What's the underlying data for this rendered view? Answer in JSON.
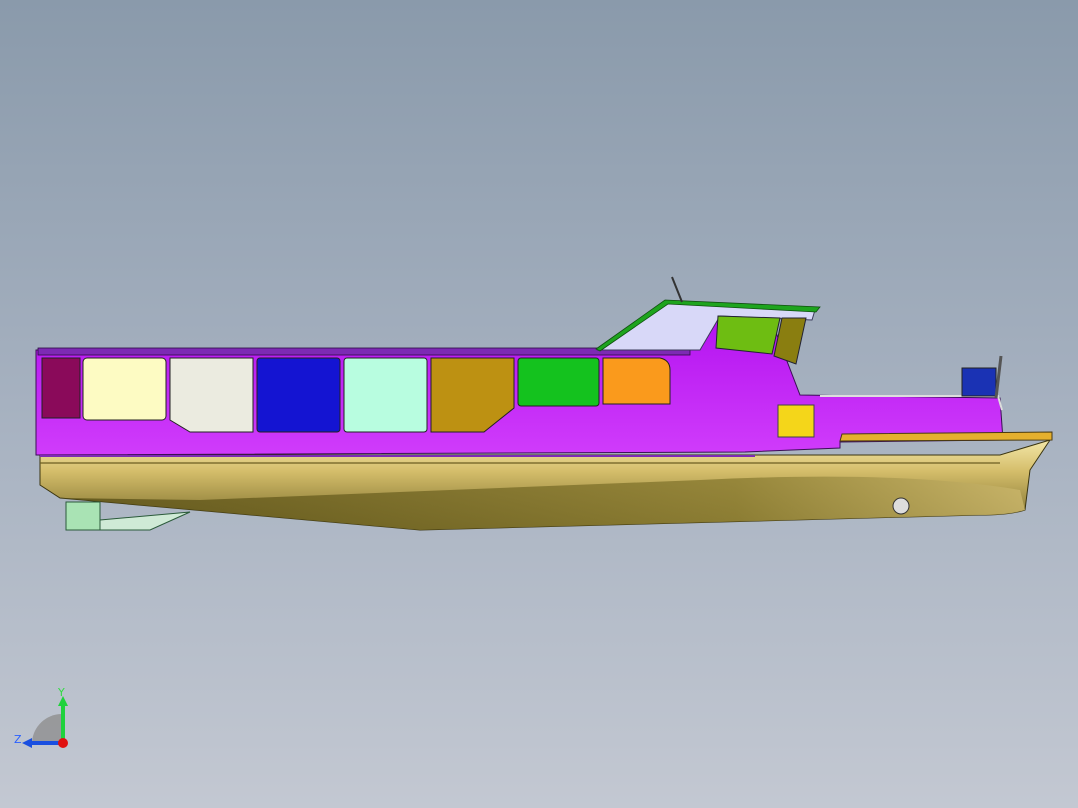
{
  "triad": {
    "y_label": "Y",
    "z_label": "Z",
    "colors": {
      "y_axis": "#1fd23c",
      "z_axis": "#1a4fe0",
      "x_axis": "#e01010",
      "label": "#2a60ff"
    }
  },
  "model": {
    "colors": {
      "hull_upper": "#e8d48a",
      "hull_lower": "#8a7a30",
      "superstructure": "#c21cf5",
      "roof_trim": "#7d2ab4",
      "cabin_front": "#d8d8f8",
      "cabin_roof": "#1ea41e",
      "aft_door": "#8a0a5a",
      "window_1": "#fdfbc3",
      "window_2": "#ebebe0",
      "window_3": "#1414d2",
      "window_4": "#b8fde0",
      "window_5": "#bd9112",
      "window_6": "#14c21e",
      "window_7": "#fa9a1c",
      "wheelhouse_window_1": "#6ebd12",
      "wheelhouse_window_2": "#8a7e10",
      "fender": "#f4d61a",
      "bow_seat": "#1a32b4",
      "rudder": "#a9e3b4"
    }
  }
}
